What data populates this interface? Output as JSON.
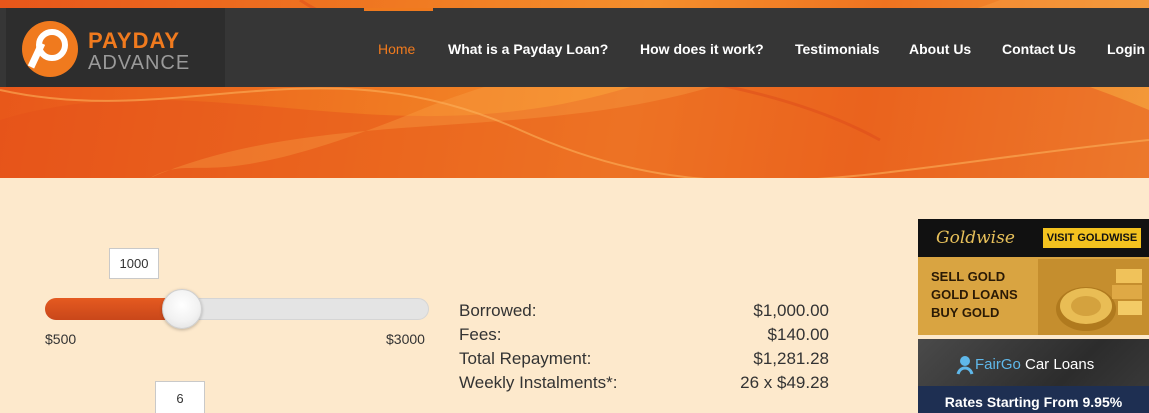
{
  "logo": {
    "word1": "PAYDAY",
    "word2": "ADVANCE"
  },
  "nav": {
    "items": [
      {
        "label": "Home",
        "active": true
      },
      {
        "label": "What is a Payday Loan?",
        "active": false
      },
      {
        "label": "How does it work?",
        "active": false
      },
      {
        "label": "Testimonials",
        "active": false
      },
      {
        "label": "About Us",
        "active": false
      },
      {
        "label": "Contact Us",
        "active": false
      },
      {
        "label": "Login",
        "active": false
      }
    ]
  },
  "calculator": {
    "amount": {
      "value": 1000,
      "display": "1000",
      "min": 500,
      "max": 3000,
      "min_label": "$500",
      "max_label": "$3000"
    },
    "weeks": {
      "display": "6"
    },
    "summary": [
      {
        "label": "Borrowed:",
        "value": "$1,000.00"
      },
      {
        "label": "Fees:",
        "value": "$140.00"
      },
      {
        "label": "Total Repayment:",
        "value": "$1,281.28"
      },
      {
        "label": "Weekly Instalments*:",
        "value": "26 x $49.28"
      }
    ]
  },
  "ads": {
    "gold": {
      "brand": "Goldwise",
      "cta": "VISIT GOLDWISE",
      "lines": [
        "SELL GOLD",
        "GOLD LOANS",
        "BUY GOLD"
      ]
    },
    "car": {
      "brand_a": "FairGo",
      "brand_b": " Car Loans",
      "tagline": "Rates Starting From 9.95%"
    }
  },
  "colors": {
    "accent": "#f07a1e",
    "nav_bg": "#363636",
    "page_bg": "#fde9cc"
  }
}
